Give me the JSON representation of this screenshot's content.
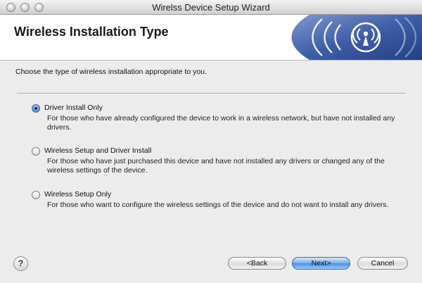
{
  "window": {
    "title": "Wirelss Device Setup Wizard"
  },
  "header": {
    "title": "Wireless Installation Type"
  },
  "prompt": "Choose the type of wireless installation appropriate to you.",
  "options": [
    {
      "label": "Driver Install Only",
      "selected": true,
      "description": "For those who have already configured the device to work in a wireless network, but have not installed any drivers."
    },
    {
      "label": "Wireless Setup and Driver Install",
      "selected": false,
      "description": "For those who have just purchased this device and have not installed any drivers or changed any of the wireless settings of the device."
    },
    {
      "label": "Wireless Setup Only",
      "selected": false,
      "description": "For those who want to configure the wireless settings of the device and do not want to install any drivers."
    }
  ],
  "buttons": {
    "help": "?",
    "back": "<Back",
    "next": "Next>",
    "cancel": "Cancel"
  },
  "icons": {
    "close": "close-icon",
    "minimize": "minimize-icon",
    "zoom": "zoom-icon",
    "wireless": "wireless-icon",
    "help": "help-icon"
  },
  "colors": {
    "banner": "#3f5ea8",
    "default_button": "#4d8fe0",
    "window_bg": "#ececec"
  }
}
